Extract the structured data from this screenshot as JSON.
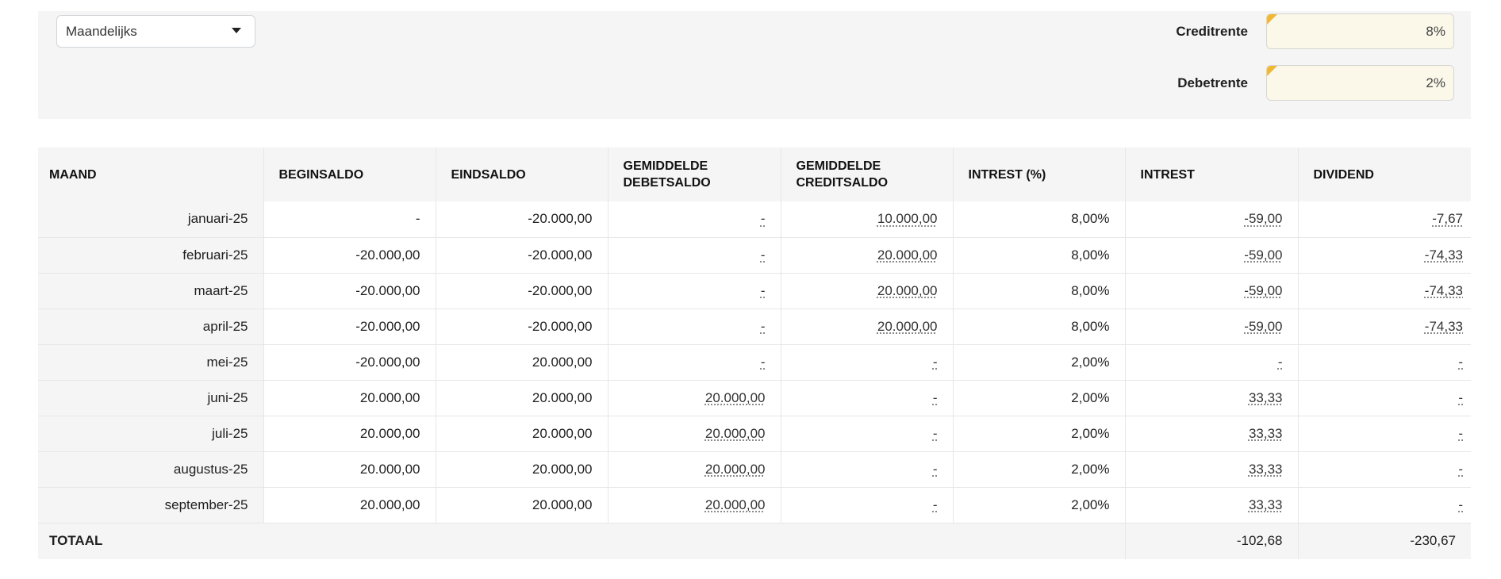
{
  "filters": {
    "period": "Maandelijks",
    "credit_rate_label": "Creditrente",
    "credit_rate_value": "8%",
    "debit_rate_label": "Debetrente",
    "debit_rate_value": "2%",
    "accent_color": "#f2b733"
  },
  "table": {
    "headers": {
      "maand": "MAAND",
      "beginsaldo": "BEGINSALDO",
      "eindsaldo": "EINDSALDO",
      "gem_debet_1": "GEMIDDELDE",
      "gem_debet_2": "DEBETSALDO",
      "gem_credit_1": "GEMIDDELDE",
      "gem_credit_2": "CREDITSALDO",
      "intrest_pct": "INTREST (%)",
      "intrest": "INTREST",
      "dividend": "DIVIDEND"
    },
    "rows": [
      {
        "maand": "januari-25",
        "begin": "-",
        "eind": "-20.000,00",
        "debet": "-",
        "credit": "10.000,00",
        "pct": "8,00%",
        "intrest": "-59,00",
        "dividend": "-7,67"
      },
      {
        "maand": "februari-25",
        "begin": "-20.000,00",
        "eind": "-20.000,00",
        "debet": "-",
        "credit": "20.000,00",
        "pct": "8,00%",
        "intrest": "-59,00",
        "dividend": "-74,33"
      },
      {
        "maand": "maart-25",
        "begin": "-20.000,00",
        "eind": "-20.000,00",
        "debet": "-",
        "credit": "20.000,00",
        "pct": "8,00%",
        "intrest": "-59,00",
        "dividend": "-74,33"
      },
      {
        "maand": "april-25",
        "begin": "-20.000,00",
        "eind": "-20.000,00",
        "debet": "-",
        "credit": "20.000,00",
        "pct": "8,00%",
        "intrest": "-59,00",
        "dividend": "-74,33"
      },
      {
        "maand": "mei-25",
        "begin": "-20.000,00",
        "eind": "20.000,00",
        "debet": "-",
        "credit": "-",
        "pct": "2,00%",
        "intrest": "-",
        "dividend": "-"
      },
      {
        "maand": "juni-25",
        "begin": "20.000,00",
        "eind": "20.000,00",
        "debet": "20.000,00",
        "credit": "-",
        "pct": "2,00%",
        "intrest": "33,33",
        "dividend": "-"
      },
      {
        "maand": "juli-25",
        "begin": "20.000,00",
        "eind": "20.000,00",
        "debet": "20.000,00",
        "credit": "-",
        "pct": "2,00%",
        "intrest": "33,33",
        "dividend": "-"
      },
      {
        "maand": "augustus-25",
        "begin": "20.000,00",
        "eind": "20.000,00",
        "debet": "20.000,00",
        "credit": "-",
        "pct": "2,00%",
        "intrest": "33,33",
        "dividend": "-"
      },
      {
        "maand": "september-25",
        "begin": "20.000,00",
        "eind": "20.000,00",
        "debet": "20.000,00",
        "credit": "-",
        "pct": "2,00%",
        "intrest": "33,33",
        "dividend": "-"
      }
    ],
    "totals": {
      "label": "TOTAAL",
      "intrest": "-102,68",
      "dividend": "-230,67"
    }
  }
}
